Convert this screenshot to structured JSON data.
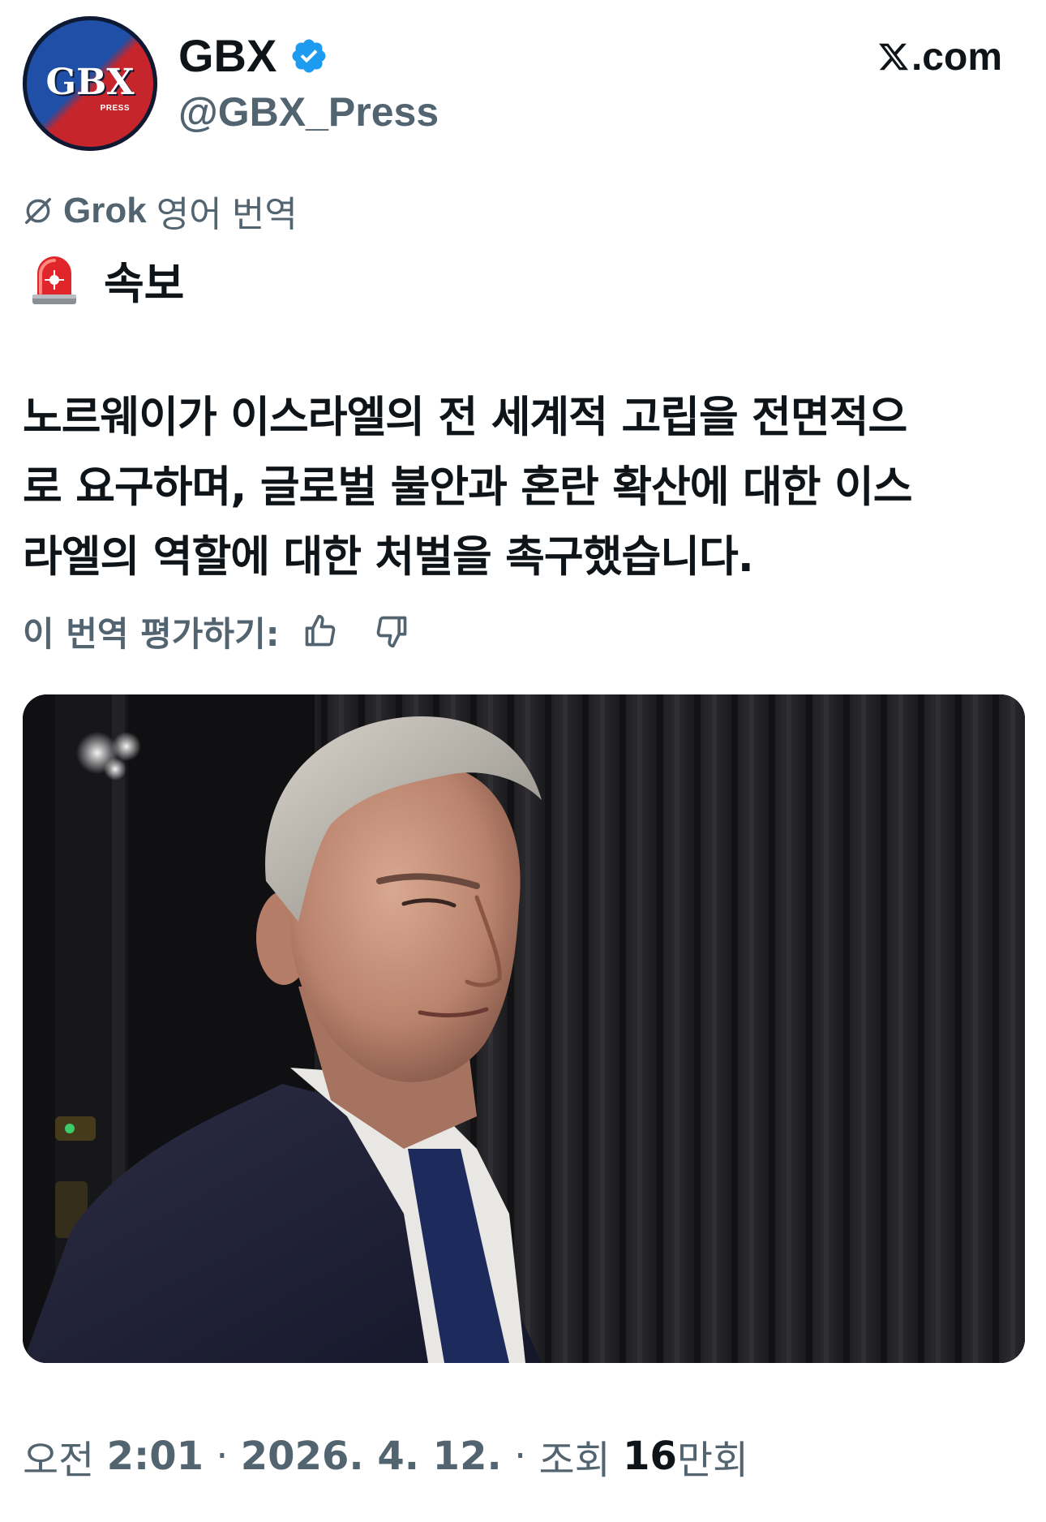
{
  "author": {
    "display_name": "GBX",
    "handle": "@GBX_Press",
    "avatar_logo_text": "GBX",
    "avatar_logo_subtext": "PRESS",
    "verified_icon": "verified-badge-icon"
  },
  "watermark": {
    "text": ".com",
    "icon": "x-logo-icon"
  },
  "translation": {
    "icon": "grok-icon",
    "brand": "Grok",
    "label": "영어 번역"
  },
  "post": {
    "breaking_icon": "siren-icon",
    "breaking_label": "속보",
    "body_lines": [
      "노르웨이가 이스라엘의 전 세계적 고립을 전면적으",
      "로 요구하며, 글로벌 불안과 혼란 확산에 대한 이스",
      "라엘의 역할에 대한 처벌을 촉구했습니다."
    ]
  },
  "rating": {
    "label": "이 번역 평가하기:",
    "up_icon": "thumbs-up-icon",
    "down_icon": "thumbs-down-icon"
  },
  "media": {
    "type": "photo"
  },
  "meta": {
    "ampm": "오전",
    "time": "2:01",
    "separator": "·",
    "date": "2026. 4. 12.",
    "views_label": "조회",
    "views_count": "16",
    "views_unit": "만회"
  },
  "colors": {
    "text_primary": "#0f1419",
    "text_secondary": "#536471",
    "verified_blue": "#1d9bf0",
    "avatar_blue": "#1f4fa6",
    "avatar_red": "#c6262b"
  }
}
